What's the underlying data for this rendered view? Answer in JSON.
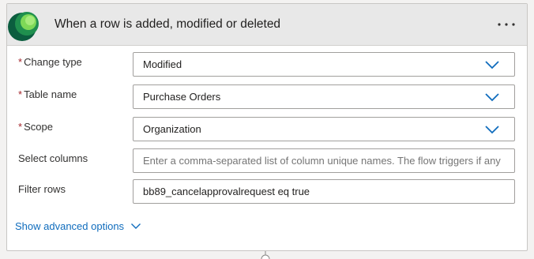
{
  "header": {
    "title": "When a row is added, modified or deleted",
    "more_icon": "ellipsis-icon",
    "logo_icon": "dataverse-logo-icon",
    "colors": {
      "header_bg": "#e8e8e8",
      "logo_dark": "#0b5d3f",
      "logo_light": "#7ed957"
    }
  },
  "fields": {
    "change_type": {
      "required": "*",
      "label": "Change type",
      "value": "Modified"
    },
    "table_name": {
      "required": "*",
      "label": "Table name",
      "value": "Purchase Orders"
    },
    "scope": {
      "required": "*",
      "label": "Scope",
      "value": "Organization"
    },
    "select_columns": {
      "label": "Select columns",
      "placeholder": "Enter a comma-separated list of column unique names. The flow triggers if any"
    },
    "filter_rows": {
      "label": "Filter rows",
      "value": "bb89_cancelapprovalrequest eq true"
    }
  },
  "advanced": {
    "label": "Show advanced options"
  },
  "colors": {
    "accent": "#0f6cbd",
    "required": "#a4262c"
  }
}
